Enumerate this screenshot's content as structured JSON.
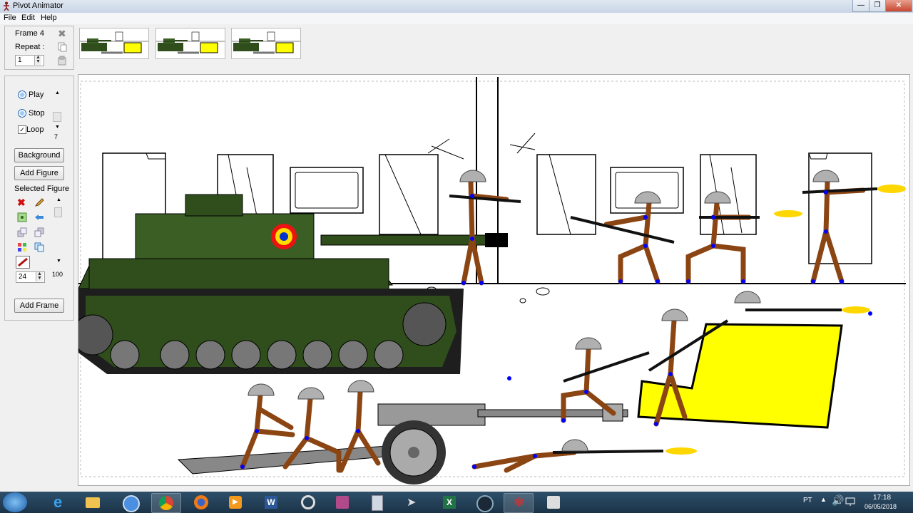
{
  "window": {
    "title": "Pivot Animator",
    "controls": [
      "minimize",
      "maximize",
      "close"
    ]
  },
  "menu": {
    "items": [
      "File",
      "Edit",
      "Help"
    ]
  },
  "frame_panel": {
    "frame_label": "Frame 4",
    "repeat_label": "Repeat :",
    "repeat_value": "1"
  },
  "thumbnails": [
    "frame-1",
    "frame-2",
    "frame-3"
  ],
  "playback": {
    "play_label": "Play",
    "stop_label": "Stop",
    "loop_label": "Loop",
    "loop_checked": true,
    "speed_value": "7"
  },
  "actions": {
    "background_label": "Background",
    "add_figure_label": "Add Figure",
    "add_frame_label": "Add Frame"
  },
  "selected_figure": {
    "heading": "Selected Figure",
    "tools": [
      "delete-icon",
      "edit-icon",
      "center-icon",
      "flip-icon",
      "send-back-icon",
      "bring-front-icon",
      "color-icon",
      "copy-icon",
      "line-color-icon"
    ],
    "size_value": "24",
    "opacity_value": "100"
  },
  "taskbar": {
    "apps": [
      "start",
      "internet-explorer",
      "file-explorer",
      "chromium",
      "chrome",
      "firefox",
      "media-player",
      "word",
      "ccleaner",
      "winrar",
      "calculator",
      "app-arrow",
      "excel",
      "steam",
      "pivot-animator",
      "pivot-stk"
    ],
    "lang": "PT",
    "time": "17:18",
    "date": "06/05/2018"
  },
  "colors": {
    "tank": "#2f4e1b",
    "figure": "#8b4513",
    "joint": "#0000ff",
    "helmet": "#b0b0b0",
    "cover": "#ffff00",
    "muzzle": "#ffd700"
  }
}
